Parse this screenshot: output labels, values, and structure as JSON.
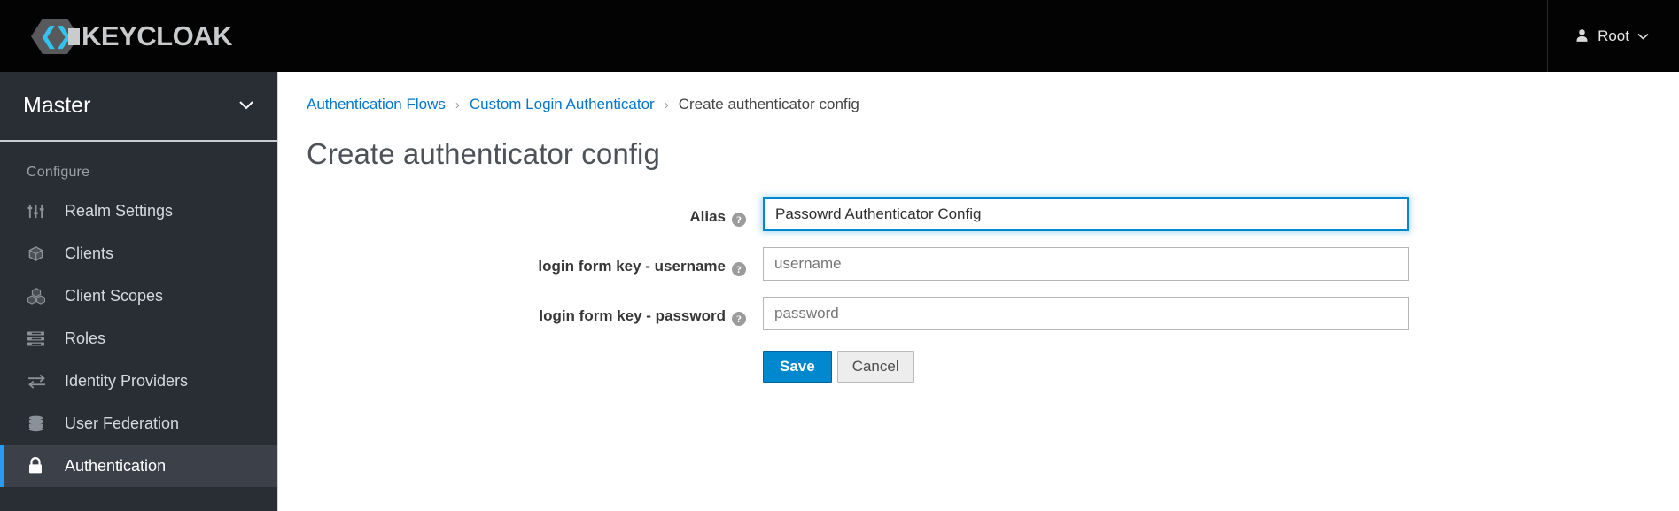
{
  "masthead": {
    "logo_text": "KEYCLOAK",
    "logo_icon": "keycloak-hex-logo",
    "user_icon": "user-avatar-icon",
    "user_label": "Root",
    "user_caret_icon": "chevron-down-icon"
  },
  "sidebar": {
    "realm": {
      "name": "Master",
      "caret_icon": "chevron-down-icon"
    },
    "section_label": "Configure",
    "items": [
      {
        "label": "Realm Settings",
        "icon": "sliders-icon",
        "active": false
      },
      {
        "label": "Clients",
        "icon": "cube-icon",
        "active": false
      },
      {
        "label": "Client Scopes",
        "icon": "cubes-icon",
        "active": false
      },
      {
        "label": "Roles",
        "icon": "list-bars-icon",
        "active": false
      },
      {
        "label": "Identity Providers",
        "icon": "exchange-icon",
        "active": false
      },
      {
        "label": "User Federation",
        "icon": "database-icon",
        "active": false
      },
      {
        "label": "Authentication",
        "icon": "lock-icon",
        "active": true
      }
    ]
  },
  "main": {
    "breadcrumb": {
      "item1": "Authentication Flows",
      "sep1": "›",
      "item2": "Custom Login Authenticator",
      "sep2": "›",
      "current": "Create authenticator config"
    },
    "page_title": "Create authenticator config",
    "form": {
      "fields": [
        {
          "label": "Alias",
          "help_icon": "question-circle-icon",
          "help_glyph": "?",
          "value": "Passowrd Authenticator Config",
          "placeholder": "",
          "focused": true
        },
        {
          "label": "login form key - username",
          "help_icon": "question-circle-icon",
          "help_glyph": "?",
          "value": "",
          "placeholder": "username",
          "focused": false
        },
        {
          "label": "login form key - password",
          "help_icon": "question-circle-icon",
          "help_glyph": "?",
          "value": "",
          "placeholder": "password",
          "focused": false
        }
      ],
      "save_label": "Save",
      "cancel_label": "Cancel"
    }
  },
  "colors": {
    "masthead_bg": "#030303",
    "sidebar_bg": "#292d34",
    "active_bg": "#3c4049",
    "accent_blue": "#2b9af3",
    "link_blue": "#0076cf",
    "primary_button": "#0088ce",
    "focus_border": "#0088ce"
  }
}
